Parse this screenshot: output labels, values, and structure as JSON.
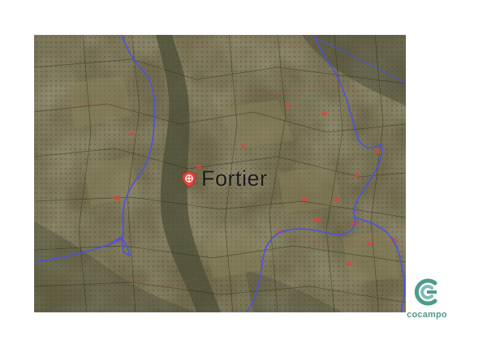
{
  "map": {
    "place_label": "Fortier",
    "imagery": "satellite",
    "marker_icon": "location-pin-icon",
    "colors": {
      "route_line": "#4b52e0",
      "parcel_highlight": "#d9453f",
      "marker_fill": "#e8403a",
      "terrain_base": "#5f5a3a"
    }
  },
  "logo": {
    "name": "cocampo",
    "color": "#4f9a8e"
  }
}
